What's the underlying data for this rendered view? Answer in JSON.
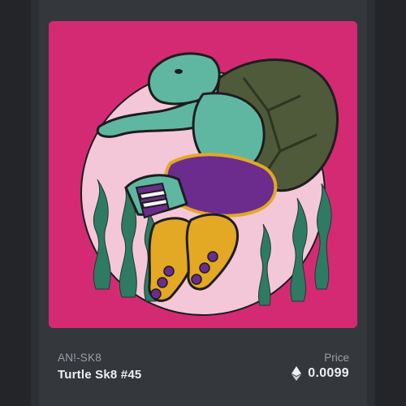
{
  "card": {
    "collection": "AN!-SK8",
    "title": "Turtle Sk8 #45",
    "price_label": "Price",
    "price_value": "0.0099",
    "currency_icon": "ethereum-icon"
  },
  "artwork": {
    "subject": "turtle-skater-illustration",
    "background_color": "#d42a74",
    "circle_color": "#f4c7d8",
    "seaweed_color": "#2f7a62",
    "skin_color": "#5fb7a2",
    "shell_color": "#4e5a3a",
    "shorts_color": "#6b2c8e",
    "skate_color": "#e3a824"
  }
}
